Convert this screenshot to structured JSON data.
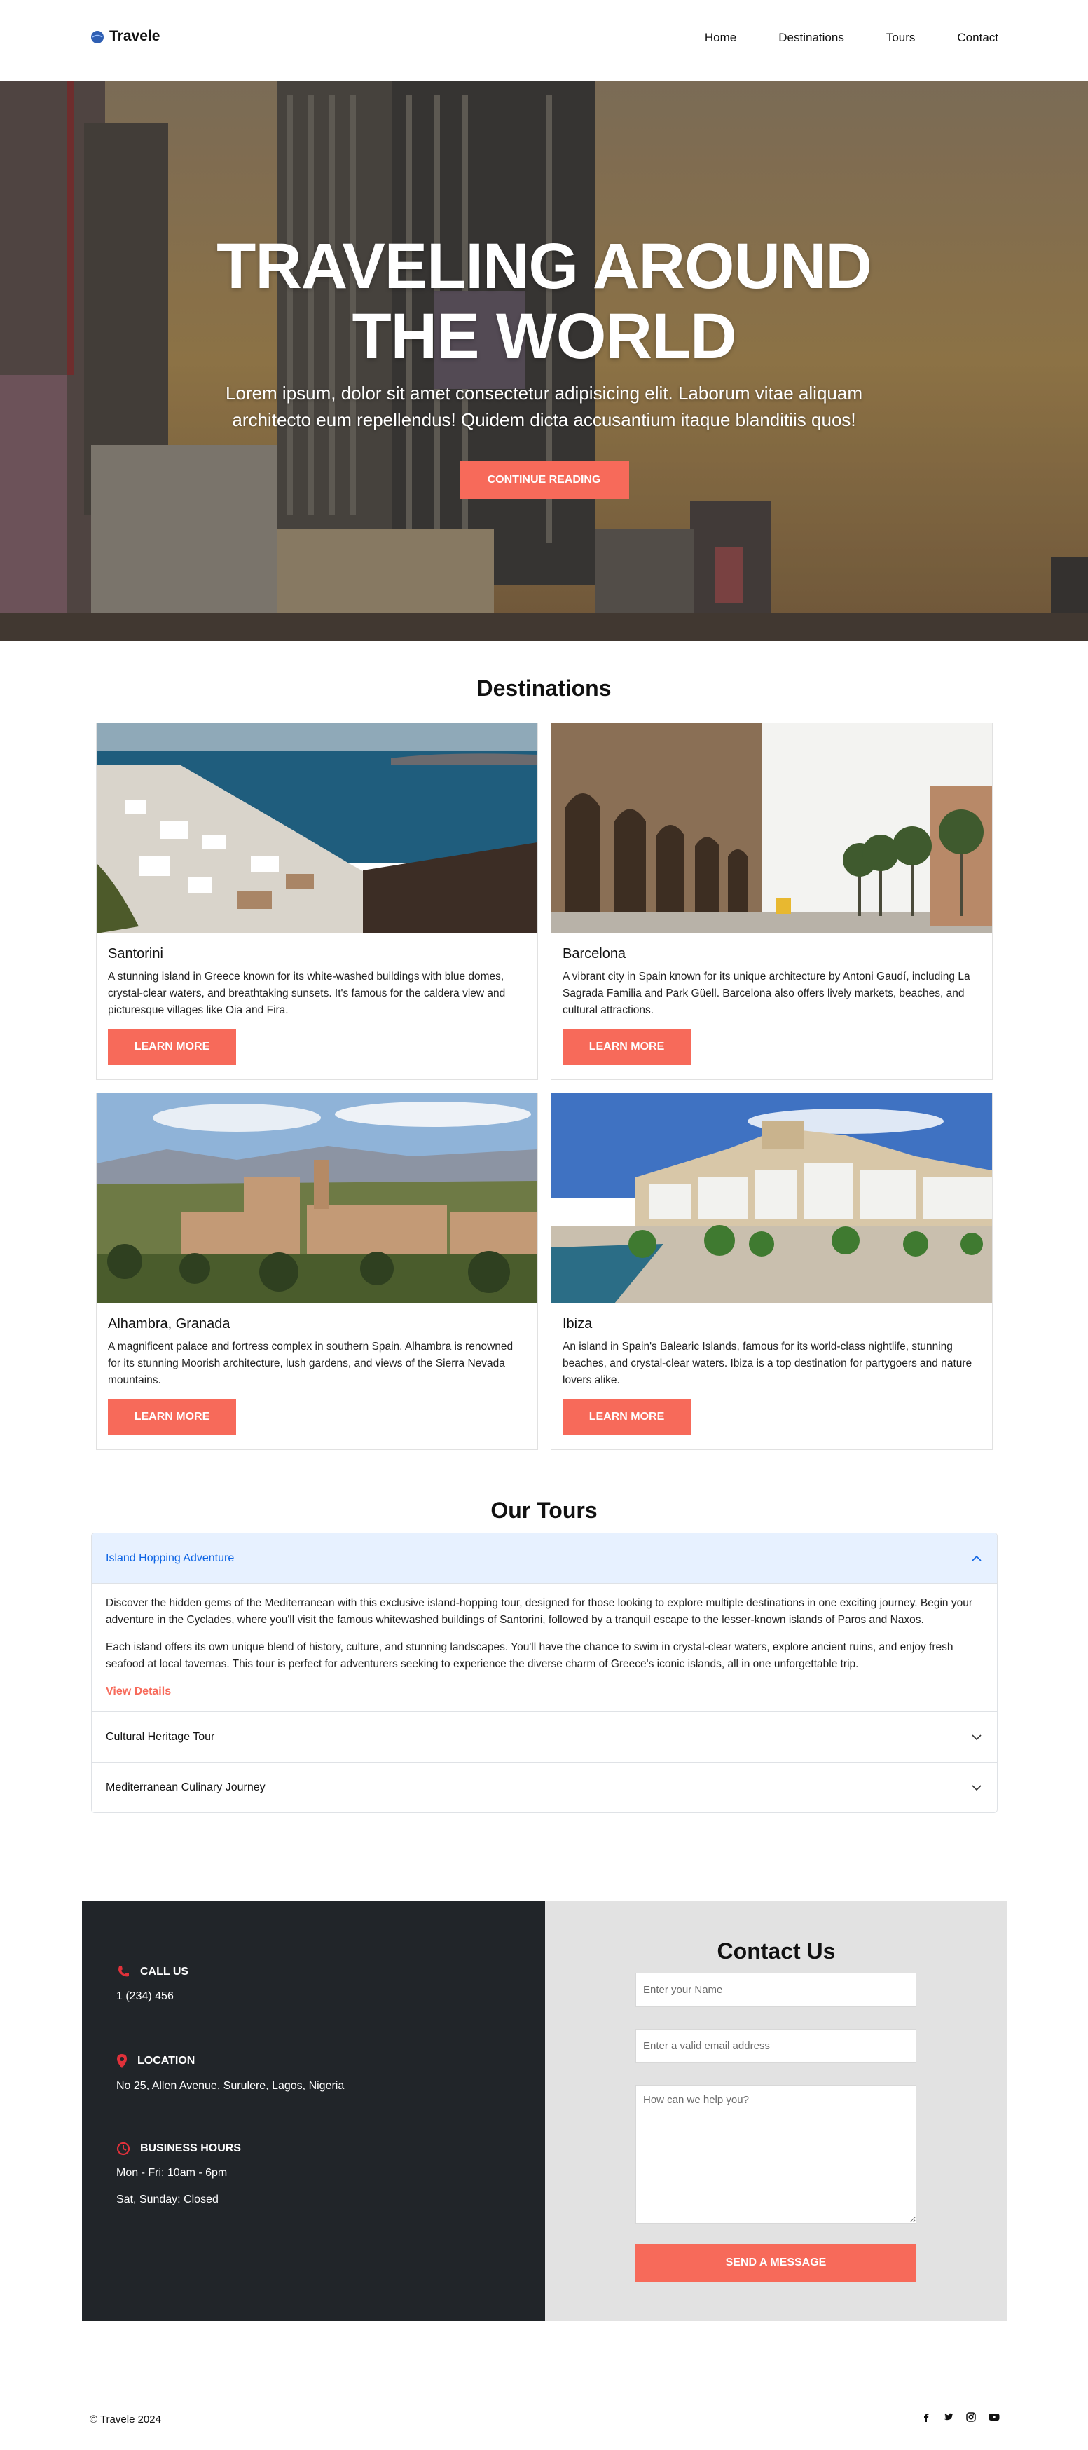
{
  "brand": {
    "name": "Travele"
  },
  "nav": {
    "items": [
      "Home",
      "Destinations",
      "Tours",
      "Contact"
    ]
  },
  "hero": {
    "title_line1": "TRAVELING AROUND",
    "title_line2": "THE WORLD",
    "text": "Lorem ipsum, dolor sit amet consectetur adipisicing elit. Laborum vitae aliquam architecto eum repellendus! Quidem dicta accusantium itaque blanditiis quos!",
    "button": "CONTINUE READING"
  },
  "destinations": {
    "title": "Destinations",
    "cards": [
      {
        "name": "Santorini",
        "description": "A stunning island in Greece known for its white-washed buildings with blue domes, crystal-clear waters, and breathtaking sunsets. It's famous for the caldera view and picturesque villages like Oia and Fira.",
        "button": "LEARN MORE"
      },
      {
        "name": "Barcelona",
        "description": "A vibrant city in Spain known for its unique architecture by Antoni Gaudí, including La Sagrada Familia and Park Güell. Barcelona also offers lively markets, beaches, and cultural attractions.",
        "button": "LEARN MORE"
      },
      {
        "name": "Alhambra, Granada",
        "description": "A magnificent palace and fortress complex in southern Spain. Alhambra is renowned for its stunning Moorish architecture, lush gardens, and views of the Sierra Nevada mountains.",
        "button": "LEARN MORE"
      },
      {
        "name": "Ibiza",
        "description": "An island in Spain's Balearic Islands, famous for its world-class nightlife, stunning beaches, and crystal-clear waters. Ibiza is a top destination for partygoers and nature lovers alike.",
        "button": "LEARN MORE"
      }
    ]
  },
  "tours": {
    "title": "Our Tours",
    "items": [
      {
        "title": "Island Hopping Adventure",
        "expanded": true,
        "paragraphs": [
          "Discover the hidden gems of the Mediterranean with this exclusive island-hopping tour, designed for those looking to explore multiple destinations in one exciting journey. Begin your adventure in the Cyclades, where you'll visit the famous whitewashed buildings of Santorini, followed by a tranquil escape to the lesser-known islands of Paros and Naxos.",
          "Each island offers its own unique blend of history, culture, and stunning landscapes. You'll have the chance to swim in crystal-clear waters, explore ancient ruins, and enjoy fresh seafood at local tavernas. This tour is perfect for adventurers seeking to experience the diverse charm of Greece's iconic islands, all in one unforgettable trip."
        ],
        "link": "View Details"
      },
      {
        "title": "Cultural Heritage Tour",
        "expanded": false
      },
      {
        "title": "Mediterranean Culinary Journey",
        "expanded": false
      }
    ]
  },
  "contact_info": {
    "call": {
      "label": "CALL US",
      "value": "1 (234) 456"
    },
    "location": {
      "label": "LOCATION",
      "value": "No 25, Allen Avenue, Surulere, Lagos, Nigeria"
    },
    "hours": {
      "label": "BUSINESS HOURS",
      "line1": "Mon - Fri: 10am - 6pm",
      "line2": "Sat, Sunday: Closed"
    }
  },
  "contact_form": {
    "title": "Contact Us",
    "name_placeholder": "Enter your Name",
    "email_placeholder": "Enter a valid email address",
    "message_placeholder": "How can we help you?",
    "button": "SEND A MESSAGE"
  },
  "footer": {
    "copyright": "© Travele 2024",
    "socials": [
      "facebook-icon",
      "twitter-icon",
      "instagram-icon",
      "youtube-icon"
    ]
  },
  "colors": {
    "accent": "#f76a5a",
    "dark": "#212529",
    "light_panel": "#e2e2e2",
    "accordion_active": "#e7f1ff",
    "link_blue": "#0c63e4"
  }
}
